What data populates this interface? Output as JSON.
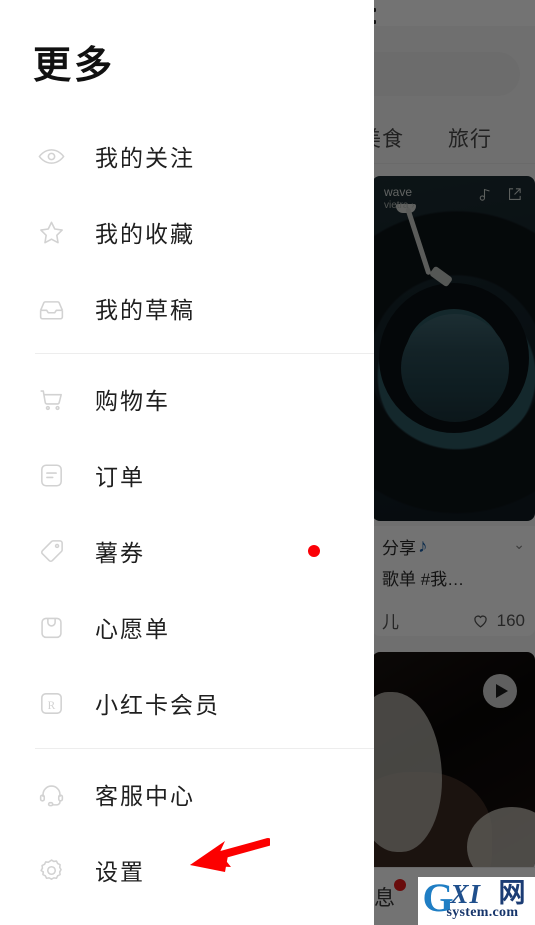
{
  "drawer": {
    "title": "更多",
    "groups": [
      {
        "items": [
          {
            "label": "我的关注",
            "icon": "eye-icon",
            "badge": false
          },
          {
            "label": "我的收藏",
            "icon": "star-icon",
            "badge": false
          },
          {
            "label": "我的草稿",
            "icon": "inbox-icon",
            "badge": false
          }
        ]
      },
      {
        "items": [
          {
            "label": "购物车",
            "icon": "shopping-cart-icon",
            "badge": false
          },
          {
            "label": "订单",
            "icon": "order-document-icon",
            "badge": false
          },
          {
            "label": "薯券",
            "icon": "coupon-tag-icon",
            "badge": true
          },
          {
            "label": "心愿单",
            "icon": "wishlist-bag-icon",
            "badge": false
          },
          {
            "label": "小红卡会员",
            "icon": "membership-card-icon",
            "badge": false
          }
        ]
      },
      {
        "items": [
          {
            "label": "客服中心",
            "icon": "headset-icon",
            "badge": false
          },
          {
            "label": "设置",
            "icon": "gear-icon",
            "badge": false
          }
        ]
      }
    ]
  },
  "background": {
    "tabs": [
      {
        "label": "美食"
      },
      {
        "label": "旅行"
      }
    ],
    "photo_card": {
      "brand_main": "wave",
      "brand_sub": "vietra ›",
      "music_icon": "music-note-icon",
      "share_icon": "share-arrow-icon"
    },
    "text_card": {
      "line1": "分享",
      "line1_emoji": "♪",
      "line2": "歌单 #我…",
      "author": "儿",
      "like_icon": "heart-icon",
      "like_count": "160",
      "chevron": "⌄"
    },
    "video_card": {
      "play_icon": "play-button-icon"
    },
    "bottom_nav": {
      "label": "息",
      "has_badge": true
    }
  },
  "annotation": {
    "arrow_color": "#fc0000",
    "points_to": "设置"
  },
  "watermark": {
    "g": "G",
    "xi": "XI",
    "cn": "网",
    "domain": "system.com"
  },
  "colors": {
    "badge_red": "#fb0007",
    "panel_bg": "#ffffff",
    "scrim": "rgba(0,0,0,0.55)",
    "label_text": "#1f1f1f",
    "icon_gray": "#d2d2d2"
  }
}
